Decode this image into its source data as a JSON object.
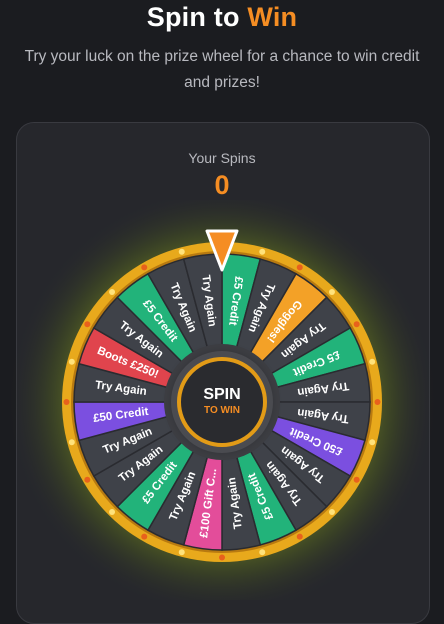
{
  "header": {
    "title_main": "Spin to",
    "title_accent": "Win",
    "subtitle": "Try your luck on the prize wheel for a chance to win credit and prizes!"
  },
  "spins": {
    "label": "Your Spins",
    "count": "0"
  },
  "spin_button": {
    "label": "SPIN",
    "sublabel": "TO WIN"
  },
  "wheel": {
    "segments": [
      {
        "label": "£5 Credit",
        "color": "#22b37a"
      },
      {
        "label": "Try Again",
        "color": "#3f4249"
      },
      {
        "label": "Goggles!",
        "color": "#f3a127"
      },
      {
        "label": "Try Again",
        "color": "#3f4249"
      },
      {
        "label": "£5 Credit",
        "color": "#22b37a"
      },
      {
        "label": "Try Again",
        "color": "#3f4249"
      },
      {
        "label": "Try Again",
        "color": "#3f4249"
      },
      {
        "label": "£50 Credit",
        "color": "#7b4fe0"
      },
      {
        "label": "Try Again",
        "color": "#3f4249"
      },
      {
        "label": "Try Again",
        "color": "#3f4249"
      },
      {
        "label": "£5 Credit",
        "color": "#22b37a"
      },
      {
        "label": "Try Again",
        "color": "#3f4249"
      },
      {
        "label": "£100 Gift C...",
        "color": "#e34d9a"
      },
      {
        "label": "Try Again",
        "color": "#3f4249"
      },
      {
        "label": "£5 Credit",
        "color": "#22b37a"
      },
      {
        "label": "Try Again",
        "color": "#3f4249"
      },
      {
        "label": "Try Again",
        "color": "#3f4249"
      },
      {
        "label": "£50 Credit",
        "color": "#7b4fe0"
      },
      {
        "label": "Try Again",
        "color": "#3f4249"
      },
      {
        "label": "Boots £250!",
        "color": "#e0444d"
      },
      {
        "label": "Try Again",
        "color": "#3f4249"
      },
      {
        "label": "£5 Credit",
        "color": "#22b37a"
      },
      {
        "label": "Try Again",
        "color": "#3f4249"
      },
      {
        "label": "Try Again",
        "color": "#3f4249"
      }
    ],
    "rim_color": "#e8a91c",
    "pointer_color": "#f58d23"
  }
}
